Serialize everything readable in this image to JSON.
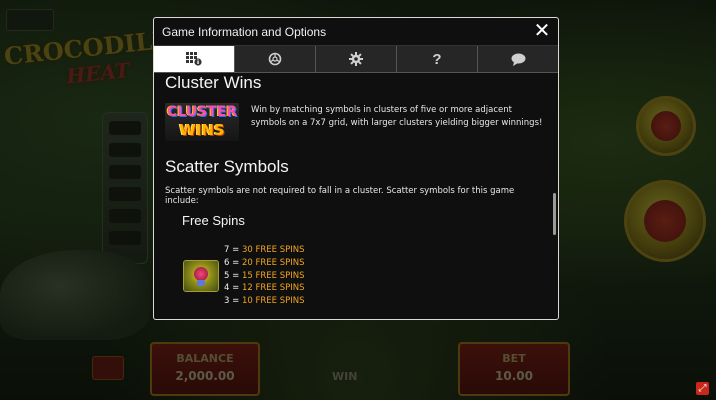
{
  "background": {
    "top_button": "",
    "logo_line1": "CROCODILE",
    "logo_line2": "HEAT",
    "balance_label": "BALANCE",
    "balance_value": "2,000.00",
    "bet_label": "BET",
    "bet_value": "10.00",
    "win_label": "WIN"
  },
  "modal": {
    "title": "Game Information and Options",
    "close_label": "✕",
    "tabs": [
      {
        "name": "paytable",
        "icon": "paytable-info-icon",
        "active": true
      },
      {
        "name": "autoplay",
        "icon": "autoplay-icon",
        "active": false
      },
      {
        "name": "settings",
        "icon": "gear-icon",
        "active": false
      },
      {
        "name": "help",
        "icon": "question-icon",
        "label": "?",
        "active": false
      },
      {
        "name": "chat",
        "icon": "chat-bubble-icon",
        "active": false
      }
    ]
  },
  "content": {
    "cluster_title": "Cluster Wins",
    "cluster_logo_line1": "CLUSTER",
    "cluster_logo_line2": "WINS",
    "cluster_text": "Win by matching symbols in clusters of five or more adjacent symbols on a 7x7 grid, with larger clusters yielding bigger winnings!",
    "scatter_title": "Scatter Symbols",
    "scatter_desc": "Scatter symbols are not required to fall in a cluster. Scatter symbols for this game include:",
    "free_spins_title": "Free Spins",
    "free_spins": [
      {
        "count": "7",
        "award": "30 FREE SPINS"
      },
      {
        "count": "6",
        "award": "20 FREE SPINS"
      },
      {
        "count": "5",
        "award": "15 FREE SPINS"
      },
      {
        "count": "4",
        "award": "12 FREE SPINS"
      },
      {
        "count": "3",
        "award": "10 FREE SPINS"
      }
    ]
  },
  "colors": {
    "accent_orange": "#f2a51e",
    "modal_bg": "#0f0f0f",
    "active_tab": "#ffffff"
  }
}
